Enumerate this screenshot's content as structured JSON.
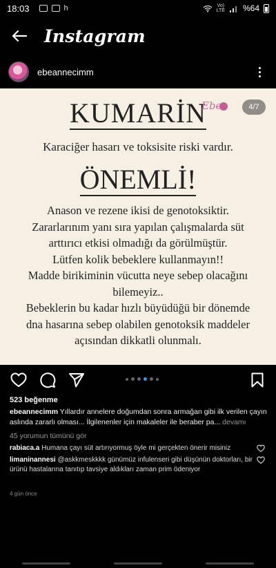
{
  "status": {
    "time": "18:03",
    "extra": "h",
    "carrier": "Vo)\nLTE",
    "battery": "%64"
  },
  "header": {
    "title": "Instagram"
  },
  "post": {
    "username": "ebeannecimm",
    "counter": "4/7",
    "image": {
      "title": "KUMARİN",
      "logo": "Ebe",
      "subtitle": "Karaciğer hasarı ve toksisite riski vardır.",
      "important": "ÖNEMLİ!",
      "body_lines": [
        "Anason ve rezene ikisi de genotoksiktir.",
        "Zararlarınım yanı sıra yapılan çalışmalarda süt",
        "arttırıcı etkisi olmadığı da görülmüştür.",
        "Lütfen kolik bebeklere kullanmayın!!",
        "Madde birikiminin vücutta neye sebep olacağını",
        "bilemeyiz..",
        "Bebeklerin bu kadar hızlı büyüdüğü bir dönemde",
        "dna hasarına sebep olabilen genotoksik maddeler",
        "açısından dikkatli olunmalı."
      ]
    },
    "likes": "523 beğenme",
    "caption_user": "ebeannecimm",
    "caption_text": " Yıllardır annelere doğumdan sonra armağan gibi ilk verilen çayın aslında zararlı olması... İlgilenenler için makaleler ile beraber pa...",
    "caption_more": " devamı",
    "view_all": "45 yorumun tümünü gör",
    "comments": [
      {
        "user": "rabiaca.a",
        "text": " Humana çayı süt artırıyormuş öyle mi gerçekten önerir misiniz"
      },
      {
        "user": "limaninannesi",
        "text": " @askkmeskkkk günümüz infulenseri gibi düşünün doktorları, bir ürünü hastalarına tanıtıp tavsiye aldıkları zaman prim ödeniyor"
      }
    ],
    "time_ago": "4 gün önce"
  }
}
